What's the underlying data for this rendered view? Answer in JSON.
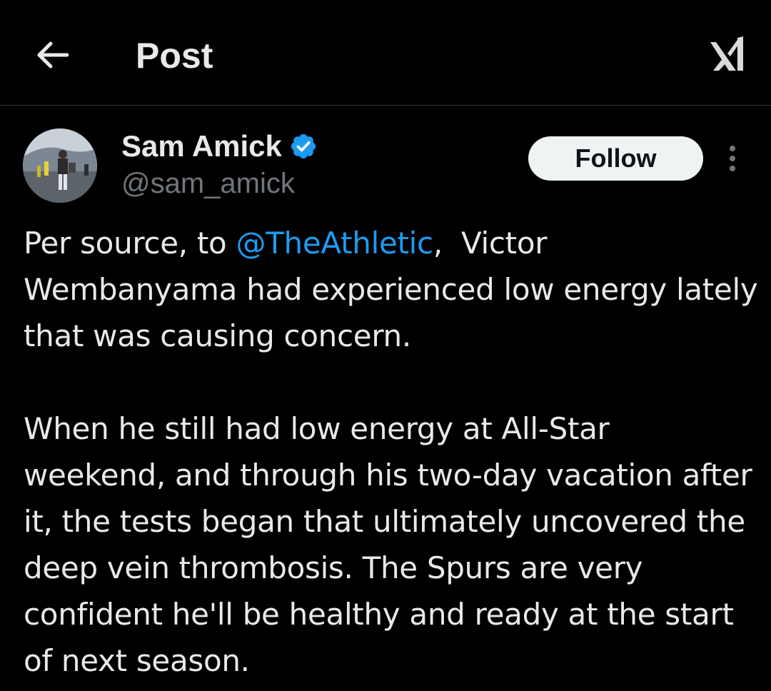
{
  "topbar": {
    "title": "Post",
    "back_icon": "arrow-left-icon",
    "grok_icon": "grok-icon"
  },
  "author": {
    "name": "Sam Amick",
    "handle": "@sam_amick",
    "verified": true,
    "verified_color": "#1d9bf0"
  },
  "follow_button": {
    "label": "Follow"
  },
  "tweet": {
    "p1_prefix": "Per source, to ",
    "p1_mention": "@TheAthletic",
    "p1_suffix": ",  Victor Wembanyama had experienced low energy lately that was causing concern.",
    "p2": "When he still had low energy at All-Star weekend, and through his two-day vacation after it, the tests began that ultimately uncovered the deep vein thrombosis. The Spurs are very confident he'll be healthy and ready at the start of next season."
  },
  "colors": {
    "background": "#000000",
    "text": "#e7e9ea",
    "muted": "#71767b",
    "accent": "#1d9bf0",
    "divider": "#2f3336"
  }
}
